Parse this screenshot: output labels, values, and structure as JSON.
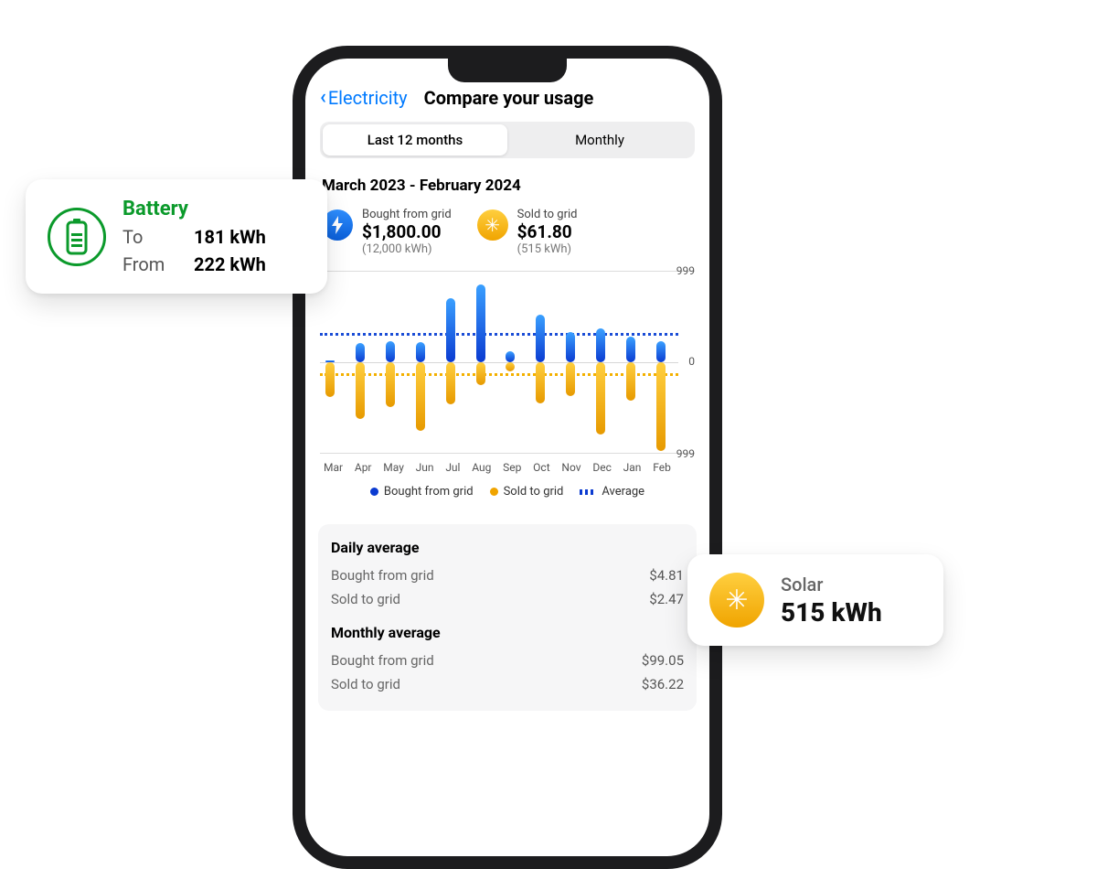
{
  "nav": {
    "back_label": "Electricity",
    "title": "Compare your usage"
  },
  "segmented": {
    "tab1": "Last 12 months",
    "tab2": "Monthly"
  },
  "range": "March 2023 - February 2024",
  "metrics": {
    "bought": {
      "label": "Bought from grid",
      "value": "$1,800.00",
      "sub": "(12,000 kWh)"
    },
    "sold": {
      "label": "Sold to grid",
      "value": "$61.80",
      "sub": "(515 kWh)"
    }
  },
  "axis": {
    "top": "999",
    "zero": "0",
    "bottom": "999"
  },
  "legend": {
    "bought": "Bought from grid",
    "sold": "Sold to grid",
    "avg": "Average"
  },
  "averages": {
    "daily_title": "Daily average",
    "daily_bought_label": "Bought from grid",
    "daily_bought": "$4.81",
    "daily_sold_label": "Sold to grid",
    "daily_sold": "$2.47",
    "monthly_title": "Monthly average",
    "monthly_bought_label": "Bought from grid",
    "monthly_bought": "$99.05",
    "monthly_sold_label": "Sold to grid",
    "monthly_sold": "$36.22"
  },
  "battery_card": {
    "title": "Battery",
    "to_label": "To",
    "to_value": "181 kWh",
    "from_label": "From",
    "from_value": "222 kWh"
  },
  "solar_card": {
    "title": "Solar",
    "value": "515 kWh"
  },
  "chart_data": {
    "type": "bar",
    "categories": [
      "Mar",
      "Apr",
      "May",
      "Jun",
      "Jul",
      "Aug",
      "Sep",
      "Oct",
      "Nov",
      "Dec",
      "Jan",
      "Feb"
    ],
    "series": [
      {
        "name": "Bought from grid",
        "values": [
          20,
          210,
          230,
          220,
          700,
          850,
          120,
          520,
          330,
          370,
          280,
          230
        ]
      },
      {
        "name": "Sold to grid",
        "values": [
          380,
          620,
          490,
          750,
          460,
          250,
          100,
          450,
          370,
          790,
          420,
          970
        ]
      }
    ],
    "average": {
      "bought": 320,
      "sold": 120
    },
    "ylabel_top": "999",
    "ylabel_bottom": "999",
    "ylim": [
      -999,
      999
    ],
    "legend": [
      "Bought from grid",
      "Sold to grid",
      "Average"
    ]
  }
}
